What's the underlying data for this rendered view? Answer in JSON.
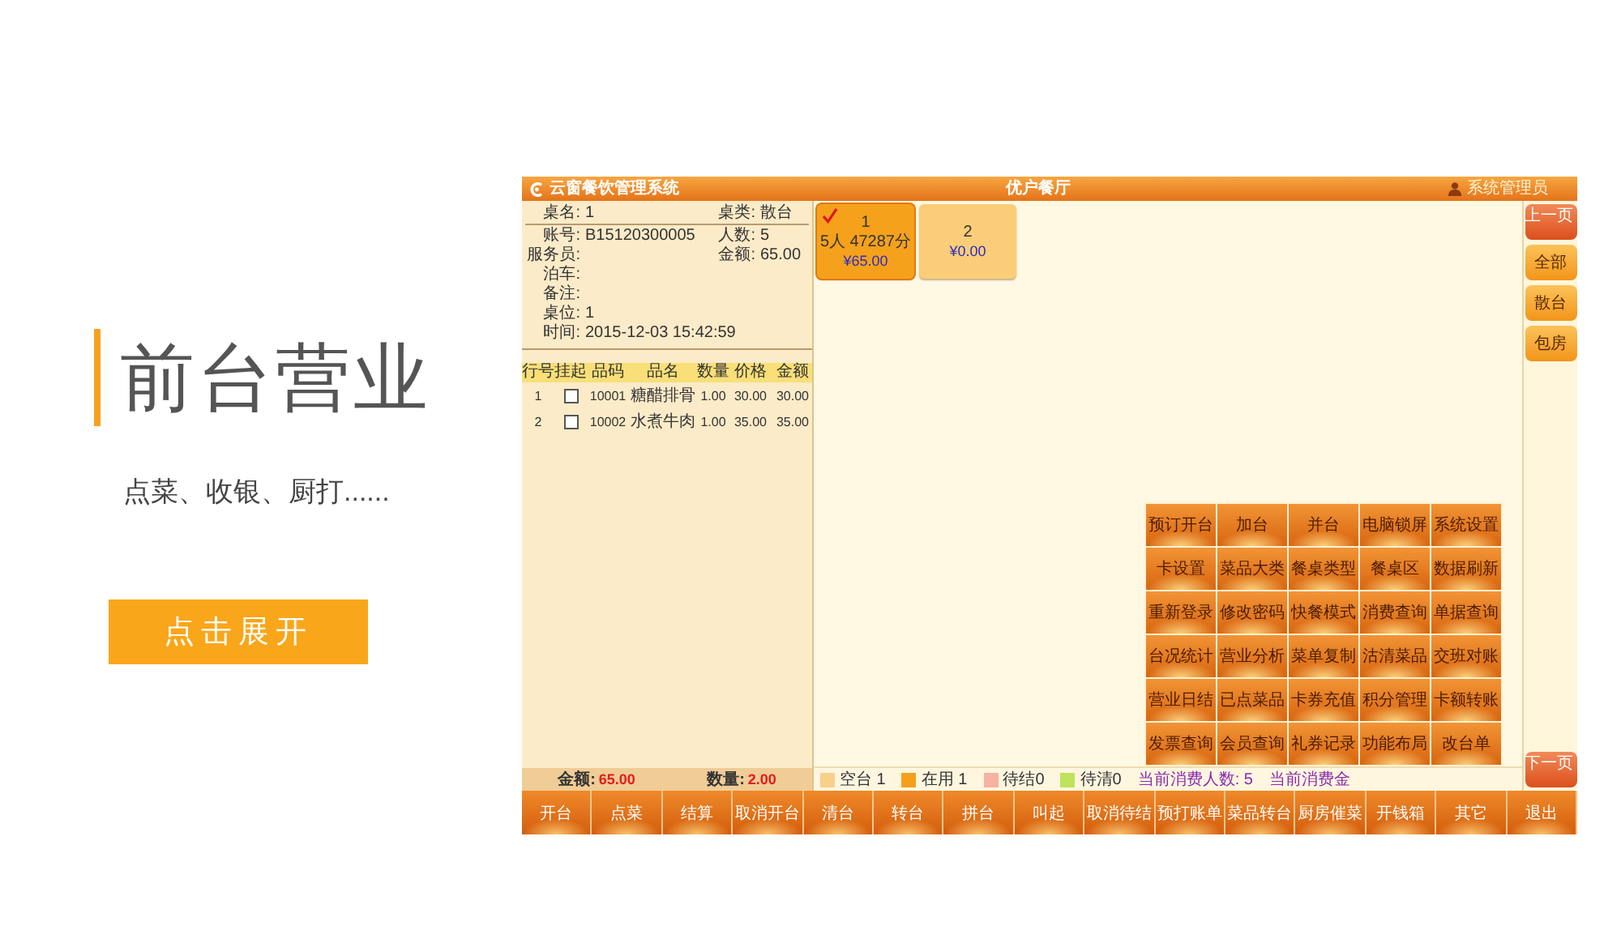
{
  "slide": {
    "title": "前台营业",
    "subtitle": "点菜、收银、厨打......",
    "action_button": "点击展开"
  },
  "app": {
    "title_bar": {
      "app_name": "云窗餐饮管理系统",
      "restaurant": "优户餐厅",
      "user": "系统管理员"
    },
    "order_info": [
      [
        {
          "label": "桌名:",
          "value": "1"
        },
        {
          "label": "桌类:",
          "value": "散台"
        }
      ],
      [
        {
          "label": "账号:",
          "value": "B15120300005"
        },
        {
          "label": "人数:",
          "value": "5"
        }
      ],
      [
        {
          "label": "服务员:"
        },
        {
          "label": "金额:",
          "value": "65.00"
        }
      ],
      [
        {
          "label": "泊车:"
        }
      ],
      [
        {
          "label": "备注:"
        }
      ],
      [
        {
          "label": "桌位:",
          "value": "1"
        }
      ],
      [
        {
          "label": "时间:",
          "value": "2015-12-03 15:42:59"
        }
      ]
    ],
    "order_table": {
      "columns": [
        "行号",
        "挂起",
        "品码",
        "品名",
        "数量",
        "价格",
        "金额"
      ],
      "rows": [
        {
          "line": "1",
          "held": false,
          "code": "10001",
          "name": "糖醋排骨",
          "quantity": "1.00",
          "price": "30.00",
          "amount": "30.00"
        },
        {
          "line": "2",
          "held": false,
          "code": "10002",
          "name": "水煮牛肉",
          "quantity": "1.00",
          "price": "35.00",
          "amount": "35.00"
        }
      ]
    },
    "order_totals": [
      {
        "label": "金额:",
        "value": "65.00"
      },
      {
        "label": "数量:",
        "value": "2.00"
      }
    ],
    "tables": [
      {
        "name": "1",
        "color": "#f6a11c",
        "selected": true,
        "guests": "5人",
        "duration": "47287分",
        "amount": "¥65.00"
      },
      {
        "name": "2",
        "color": "#fbcd78",
        "selected": false,
        "amount": "¥0.00"
      }
    ],
    "functions": [
      "预订开台",
      "加台",
      "并台",
      "电脑锁屏",
      "系统设置",
      "卡设置",
      "菜品大类",
      "餐桌类型",
      "餐桌区",
      "数据刷新",
      "重新登录",
      "修改密码",
      "快餐模式",
      "消费查询",
      "单据查询",
      "台况统计",
      "营业分析",
      "菜单复制",
      "沽清菜品",
      "交班对账",
      "营业日结",
      "已点菜品",
      "卡券充值",
      "积分管理",
      "卡额转账",
      "发票查询",
      "会员查询",
      "礼券记录",
      "功能布局",
      "改台单"
    ],
    "legend": [
      {
        "label": "空台 1",
        "color": "#f8d08a"
      },
      {
        "label": "在用 1",
        "color": "#f5a01a"
      },
      {
        "label": "待结0",
        "color": "#f6b2a2"
      },
      {
        "label": "待清0",
        "color": "#bfe35a"
      }
    ],
    "summary": [
      "当前消费人数: 5",
      "当前消费金"
    ],
    "side_nav": {
      "top": [
        {
          "label": "上一页",
          "kind": "page"
        },
        {
          "label": "全部",
          "kind": "filter"
        },
        {
          "label": "散台",
          "kind": "filter"
        },
        {
          "label": "包房",
          "kind": "filter"
        }
      ],
      "bottom": [
        {
          "label": "下一页",
          "kind": "page"
        }
      ]
    },
    "bottom_bar": [
      "开台",
      "点菜",
      "结算",
      "取消开台",
      "清台",
      "转台",
      "拼台",
      "叫起",
      "取消待结",
      "预打账单",
      "菜品转台",
      "厨房催菜",
      "开钱箱",
      "其它",
      "退出"
    ]
  }
}
